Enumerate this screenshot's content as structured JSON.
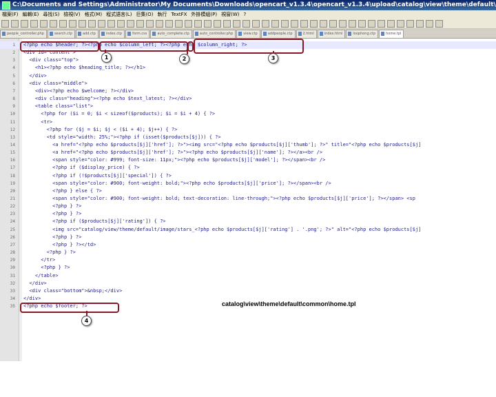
{
  "window": {
    "title": "C:\\Documents and Settings\\Administrator\\My Documents\\Downloads\\opencart_v1.3.4\\opencart_v1.3.4\\upload\\catalog\\view\\theme\\default\\template\\common\\home.tpl - Notepad++"
  },
  "menu": [
    "檔案(F)",
    "編輯(E)",
    "尋找(S)",
    "檢視(V)",
    "格式(M)",
    "程式語言(L)",
    "巨集(O)",
    "執行",
    "TextFX",
    "外掛模組(P)",
    "視窗(W)",
    "?"
  ],
  "tabs": [
    {
      "label": "people_controller.php",
      "active": false
    },
    {
      "label": "search.ctp",
      "active": false
    },
    {
      "label": "add.ctp",
      "active": false
    },
    {
      "label": "index.ctp",
      "active": false
    },
    {
      "label": "form.css",
      "active": false
    },
    {
      "label": "auto_complete.ctp",
      "active": false
    },
    {
      "label": "auto_controller.php",
      "active": false
    },
    {
      "label": "view.ctp",
      "active": false
    },
    {
      "label": "addpeople.ctp",
      "active": false
    },
    {
      "label": "2.html",
      "active": false
    },
    {
      "label": "index.html",
      "active": false
    },
    {
      "label": "loophong.ctp",
      "active": false
    },
    {
      "label": "home.tpl",
      "active": true
    }
  ],
  "code_lines": [
    {
      "n": "1",
      "text": "<?php echo $header; ?><?php echo $column_left; ?><?php echo $column_right; ?>"
    },
    {
      "n": "2",
      "text": "<div id=\"content\">"
    },
    {
      "n": "3",
      "text": "  <div class=\"top\">"
    },
    {
      "n": "4",
      "text": "    <h1><?php echo $heading_title; ?></h1>"
    },
    {
      "n": "5",
      "text": "  </div>"
    },
    {
      "n": "6",
      "text": "  <div class=\"middle\">"
    },
    {
      "n": "7",
      "text": "    <div><?php echo $welcome; ?></div>"
    },
    {
      "n": "8",
      "text": "    <div class=\"heading\"><?php echo $text_latest; ?></div>"
    },
    {
      "n": "9",
      "text": "    <table class=\"list\">"
    },
    {
      "n": "10",
      "text": "      <?php for ($i = 0; $i < sizeof($products); $i = $i + 4) { ?>"
    },
    {
      "n": "11",
      "text": "      <tr>"
    },
    {
      "n": "12",
      "text": "        <?php for ($j = $i; $j < ($i + 4); $j++) { ?>"
    },
    {
      "n": "13",
      "text": "        <td style=\"width: 25%;\"><?php if (isset($products[$j])) { ?>"
    },
    {
      "n": "14",
      "text": "          <a href=\"<?php echo $products[$j]['href']; ?>\"><img src=\"<?php echo $products[$j]['thumb']; ?>\" title=\"<?php echo $products[$j]"
    },
    {
      "n": "15",
      "text": "          <a href=\"<?php echo $products[$j]['href']; ?>\"><?php echo $products[$j]['name']; ?></a><br />"
    },
    {
      "n": "16",
      "text": "          <span style=\"color: #999; font-size: 11px;\"><?php echo $products[$j]['model']; ?></span><br />"
    },
    {
      "n": "17",
      "text": "          <?php if ($display_price) { ?>"
    },
    {
      "n": "18",
      "text": "          <?php if (!$products[$j]['special']) { ?>"
    },
    {
      "n": "19",
      "text": "          <span style=\"color: #900; font-weight: bold;\"><?php echo $products[$j]['price']; ?></span><br />"
    },
    {
      "n": "20",
      "text": "          <?php } else { ?>"
    },
    {
      "n": "21",
      "text": "          <span style=\"color: #900; font-weight: bold; text-decoration: line-through;\"><?php echo $products[$j]['price']; ?></span> <sp"
    },
    {
      "n": "22",
      "text": "          <?php } ?>"
    },
    {
      "n": "23",
      "text": "          <?php } ?>"
    },
    {
      "n": "24",
      "text": "          <?php if ($products[$j]['rating']) { ?>"
    },
    {
      "n": "25",
      "text": "          <img src=\"catalog/view/theme/default/image/stars_<?php echo $products[$j]['rating'] . '.png'; ?>\" alt=\"<?php echo $products[$j]"
    },
    {
      "n": "26",
      "text": "          <?php } ?>"
    },
    {
      "n": "27",
      "text": "          <?php } ?></td>"
    },
    {
      "n": "28",
      "text": "        <?php } ?>"
    },
    {
      "n": "29",
      "text": "      </tr>"
    },
    {
      "n": "30",
      "text": "      <?php } ?>"
    },
    {
      "n": "31",
      "text": "    </table>"
    },
    {
      "n": "32",
      "text": "  </div>"
    },
    {
      "n": "33",
      "text": "  <div class=\"bottom\">&nbsp;</div>"
    },
    {
      "n": "34",
      "text": "</div>"
    },
    {
      "n": "35",
      "text": "<?php echo $footer; ?>"
    }
  ],
  "annotations": {
    "callouts": [
      "1",
      "2",
      "3",
      "4"
    ],
    "path_label": "catalog\\view\\theme\\default\\common\\home.tpl",
    "color": "#8a1525"
  }
}
